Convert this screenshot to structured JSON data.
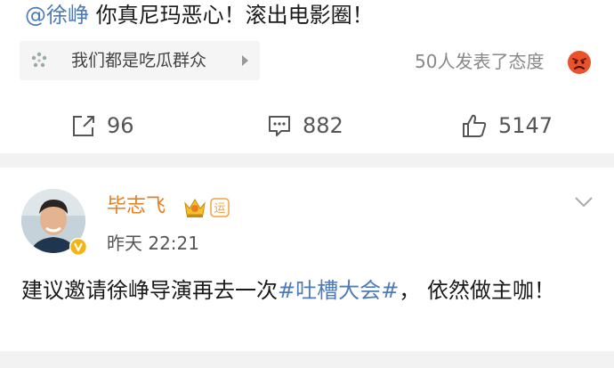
{
  "post": {
    "mention": "@徐峥",
    "text": " 你真尼玛恶心！滚出电影圈！",
    "topic_label": "我们都是吃瓜群众",
    "attitude_text": "50人发表了态度",
    "actions": {
      "share_count": "96",
      "comment_count": "882",
      "like_count": "5147"
    }
  },
  "comment": {
    "user_name": "毕志飞",
    "badge_text": "运",
    "timestamp": "昨天 22:21",
    "text_before": "建议邀请徐峥导演再去一次",
    "hashtag": "#吐槽大会#",
    "text_after": "， 依然做主咖！"
  },
  "colors": {
    "link_blue": "#4d7bb8",
    "username_orange": "#e67e22",
    "angry_red": "#e8532c",
    "verified_yellow": "#f3b515"
  },
  "icons": [
    "topic-icon",
    "angry-face-icon",
    "share-icon",
    "comment-icon",
    "like-icon",
    "verified-icon",
    "crown-icon",
    "chevron-down-icon"
  ]
}
